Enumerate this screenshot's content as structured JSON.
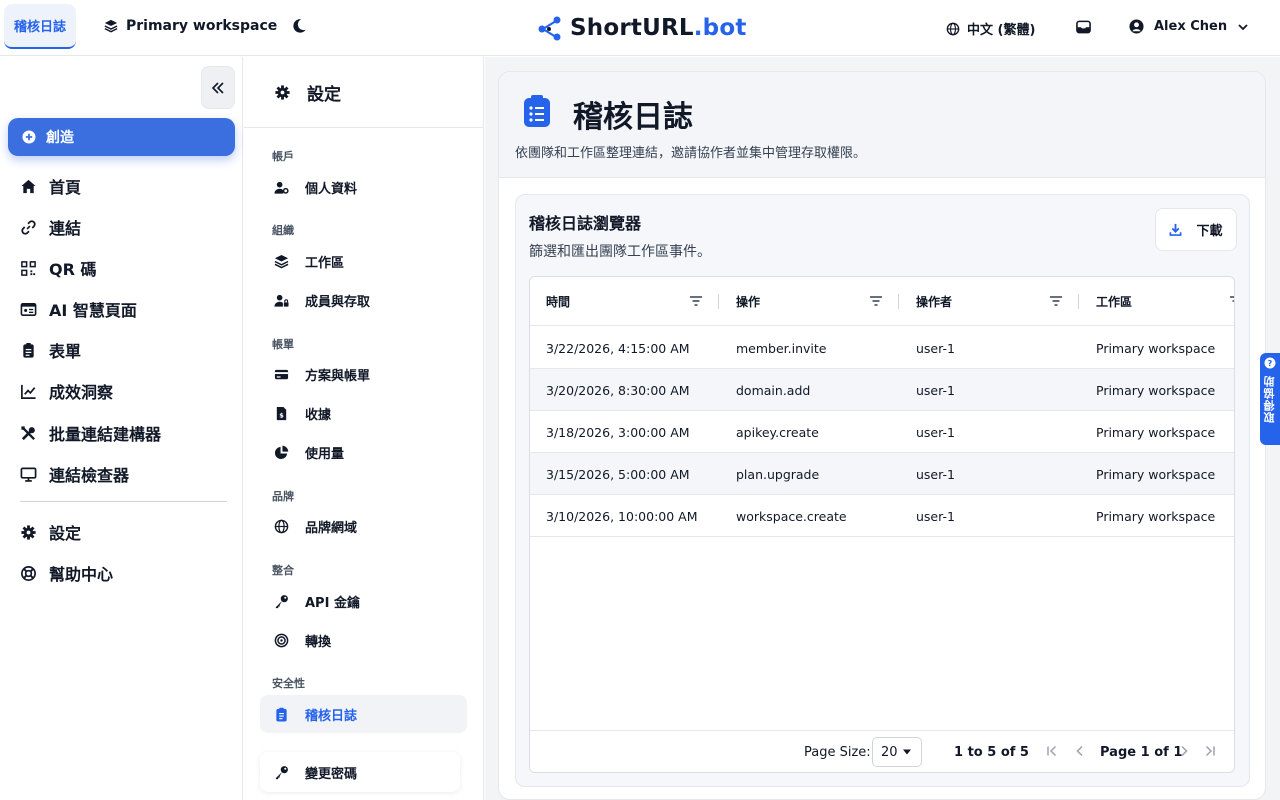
{
  "topbar": {
    "active_tab": "稽核日誌",
    "workspace": "Primary workspace",
    "logo_main": "ShortURL",
    "logo_suffix": ".bot",
    "language": "中文 (繁體)",
    "user_name": "Alex Chen"
  },
  "sidebar": {
    "create_label": "創造",
    "items": [
      {
        "label": "首頁",
        "icon": "home-icon"
      },
      {
        "label": "連結",
        "icon": "link-icon"
      },
      {
        "label": "QR 碼",
        "icon": "qrcode-icon"
      },
      {
        "label": "AI 智慧頁面",
        "icon": "id-card-icon"
      },
      {
        "label": "表單",
        "icon": "clipboard-icon"
      },
      {
        "label": "成效洞察",
        "icon": "chart-line-icon"
      },
      {
        "label": "批量連結建構器",
        "icon": "tools-icon"
      },
      {
        "label": "連結檢查器",
        "icon": "monitor-icon"
      }
    ],
    "bottom_items": [
      {
        "label": "設定",
        "icon": "gear-icon"
      },
      {
        "label": "幫助中心",
        "icon": "lifebuoy-icon"
      }
    ]
  },
  "settings": {
    "title": "設定",
    "groups": [
      {
        "label": "帳戶",
        "items": [
          {
            "label": "個人資料",
            "icon": "user-gear-icon"
          }
        ]
      },
      {
        "label": "組織",
        "items": [
          {
            "label": "工作區",
            "icon": "layers-icon"
          },
          {
            "label": "成員與存取",
            "icon": "user-lock-icon"
          }
        ]
      },
      {
        "label": "帳單",
        "items": [
          {
            "label": "方案與帳單",
            "icon": "credit-card-icon"
          },
          {
            "label": "收據",
            "icon": "receipt-icon"
          },
          {
            "label": "使用量",
            "icon": "pie-chart-icon"
          }
        ]
      },
      {
        "label": "品牌",
        "items": [
          {
            "label": "品牌網域",
            "icon": "globe-icon"
          }
        ]
      },
      {
        "label": "整合",
        "items": [
          {
            "label": "API 金鑰",
            "icon": "key-icon"
          },
          {
            "label": "轉換",
            "icon": "target-icon"
          }
        ]
      },
      {
        "label": "安全性",
        "items": []
      }
    ],
    "active_item": "稽核日誌",
    "password_item": "變更密碼"
  },
  "main": {
    "title": "稽核日誌",
    "description": "依團隊和工作區整理連結，邀請協作者並集中管理存取權限。",
    "card_title": "稽核日誌瀏覽器",
    "card_subtitle": "篩選和匯出團隊工作區事件。",
    "download_label": "下載",
    "columns": [
      "時間",
      "操作",
      "操作者",
      "工作區"
    ],
    "rows": [
      {
        "time": "3/22/2026, 4:15:00 AM",
        "action": "member.invite",
        "actor": "user-1",
        "workspace": "Primary workspace"
      },
      {
        "time": "3/20/2026, 8:30:00 AM",
        "action": "domain.add",
        "actor": "user-1",
        "workspace": "Primary workspace"
      },
      {
        "time": "3/18/2026, 3:00:00 AM",
        "action": "apikey.create",
        "actor": "user-1",
        "workspace": "Primary workspace"
      },
      {
        "time": "3/15/2026, 5:00:00 AM",
        "action": "plan.upgrade",
        "actor": "user-1",
        "workspace": "Primary workspace"
      },
      {
        "time": "3/10/2026, 10:00:00 AM",
        "action": "workspace.create",
        "actor": "user-1",
        "workspace": "Primary workspace"
      }
    ],
    "pagination": {
      "page_size_label": "Page Size:",
      "page_size": "20",
      "range_text": "1 to 5 of 5",
      "page_prefix": "Page",
      "page_current": "1",
      "page_of": "of",
      "page_total": "1"
    }
  },
  "feedback_label": "取得協助",
  "colors": {
    "accent": "#2563eb",
    "primary_button": "#3b6fe0"
  }
}
